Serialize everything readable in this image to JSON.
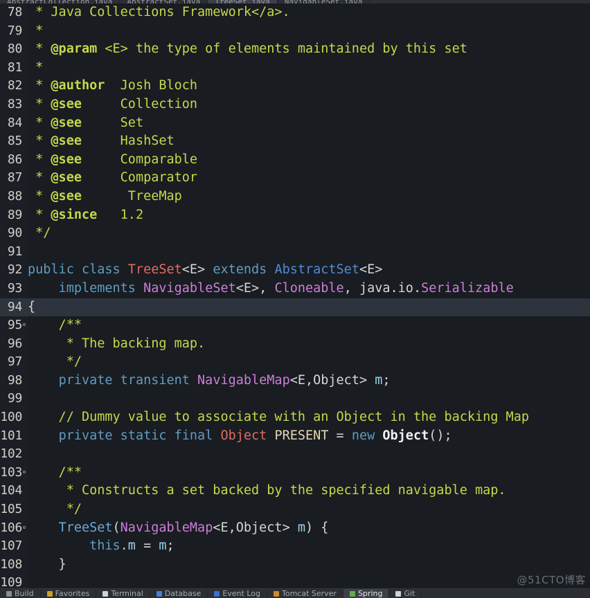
{
  "window": {
    "title": "TreeSet.java",
    "watermark": "@51CTO博客"
  },
  "tabs": [
    {
      "label": "AbstractCollection.java",
      "active": false
    },
    {
      "label": "AbstractSet.java",
      "active": false
    },
    {
      "label": "TreeSet.java",
      "active": true
    },
    {
      "label": "NavigableSet.java",
      "active": false
    }
  ],
  "tool_windows": [
    {
      "label": "Build",
      "icon": "build-icon",
      "color": "#8a8f98",
      "selected": false
    },
    {
      "label": "Favorites",
      "icon": "favorites-icon",
      "color": "#c9a227",
      "selected": false
    },
    {
      "label": "Terminal",
      "icon": "terminal-icon",
      "color": "#cfd2d6",
      "selected": false
    },
    {
      "label": "Database",
      "icon": "database-icon",
      "color": "#4a7fd4",
      "selected": false
    },
    {
      "label": "Event Log",
      "icon": "event-log-icon",
      "color": "#3b6fd0",
      "selected": false
    },
    {
      "label": "Tomcat Server",
      "icon": "tomcat-icon",
      "color": "#d08a2a",
      "selected": false
    },
    {
      "label": "Spring",
      "icon": "spring-icon",
      "color": "#6aa84f",
      "selected": true
    },
    {
      "label": "Git",
      "icon": "git-icon",
      "color": "#cfd2d6",
      "selected": false
    }
  ],
  "editor": {
    "language": "java",
    "first_line": 78,
    "current_line": 94,
    "lines": [
      {
        "n": 78,
        "fold": false,
        "current": false,
        "tokens": [
          {
            "c": "t-cmt",
            "t": " * Java Collections Framework</a>."
          }
        ]
      },
      {
        "n": 79,
        "fold": false,
        "current": false,
        "tokens": [
          {
            "c": "t-cmt",
            "t": " *"
          }
        ]
      },
      {
        "n": 80,
        "fold": false,
        "current": false,
        "tokens": [
          {
            "c": "t-cmt",
            "t": " * "
          },
          {
            "c": "t-cmtb",
            "t": "@param"
          },
          {
            "c": "t-cmt",
            "t": " <E> the type of elements maintained by this set"
          }
        ]
      },
      {
        "n": 81,
        "fold": false,
        "current": false,
        "tokens": [
          {
            "c": "t-cmt",
            "t": " *"
          }
        ]
      },
      {
        "n": 82,
        "fold": false,
        "current": false,
        "tokens": [
          {
            "c": "t-cmt",
            "t": " * "
          },
          {
            "c": "t-cmtb",
            "t": "@author"
          },
          {
            "c": "t-cmt",
            "t": "  Josh Bloch"
          }
        ]
      },
      {
        "n": 83,
        "fold": false,
        "current": false,
        "tokens": [
          {
            "c": "t-cmt",
            "t": " * "
          },
          {
            "c": "t-cmtb",
            "t": "@see"
          },
          {
            "c": "t-cmt",
            "t": "     Collection"
          }
        ]
      },
      {
        "n": 84,
        "fold": false,
        "current": false,
        "tokens": [
          {
            "c": "t-cmt",
            "t": " * "
          },
          {
            "c": "t-cmtb",
            "t": "@see"
          },
          {
            "c": "t-cmt",
            "t": "     Set"
          }
        ]
      },
      {
        "n": 85,
        "fold": false,
        "current": false,
        "tokens": [
          {
            "c": "t-cmt",
            "t": " * "
          },
          {
            "c": "t-cmtb",
            "t": "@see"
          },
          {
            "c": "t-cmt",
            "t": "     HashSet"
          }
        ]
      },
      {
        "n": 86,
        "fold": false,
        "current": false,
        "tokens": [
          {
            "c": "t-cmt",
            "t": " * "
          },
          {
            "c": "t-cmtb",
            "t": "@see"
          },
          {
            "c": "t-cmt",
            "t": "     Comparable"
          }
        ]
      },
      {
        "n": 87,
        "fold": false,
        "current": false,
        "tokens": [
          {
            "c": "t-cmt",
            "t": " * "
          },
          {
            "c": "t-cmtb",
            "t": "@see"
          },
          {
            "c": "t-cmt",
            "t": "     Comparator"
          }
        ]
      },
      {
        "n": 88,
        "fold": false,
        "current": false,
        "tokens": [
          {
            "c": "t-cmt",
            "t": " * "
          },
          {
            "c": "t-cmtb",
            "t": "@see"
          },
          {
            "c": "t-cmt",
            "t": "      TreeMap"
          }
        ]
      },
      {
        "n": 89,
        "fold": false,
        "current": false,
        "tokens": [
          {
            "c": "t-cmt",
            "t": " * "
          },
          {
            "c": "t-cmtb",
            "t": "@since"
          },
          {
            "c": "t-cmt",
            "t": "   1.2"
          }
        ]
      },
      {
        "n": 90,
        "fold": false,
        "current": false,
        "tokens": [
          {
            "c": "t-cmt",
            "t": " */"
          }
        ]
      },
      {
        "n": 91,
        "fold": false,
        "current": false,
        "tokens": []
      },
      {
        "n": 92,
        "fold": false,
        "current": false,
        "tokens": [
          {
            "c": "t-kw",
            "t": "public class "
          },
          {
            "c": "t-cls",
            "t": "TreeSet"
          },
          {
            "c": "t-plain",
            "t": "<E> "
          },
          {
            "c": "t-kw",
            "t": "extends "
          },
          {
            "c": "t-type2",
            "t": "AbstractSet"
          },
          {
            "c": "t-plain",
            "t": "<E>"
          }
        ]
      },
      {
        "n": 93,
        "fold": false,
        "current": false,
        "tokens": [
          {
            "c": "t-plain",
            "t": "    "
          },
          {
            "c": "t-kw",
            "t": "implements "
          },
          {
            "c": "t-iface",
            "t": "NavigableSet"
          },
          {
            "c": "t-plain",
            "t": "<E>, "
          },
          {
            "c": "t-iface",
            "t": "Cloneable"
          },
          {
            "c": "t-plain",
            "t": ", java.io."
          },
          {
            "c": "t-iface",
            "t": "Serializable"
          }
        ]
      },
      {
        "n": 94,
        "fold": false,
        "current": true,
        "tokens": [
          {
            "c": "t-plain",
            "t": "{"
          }
        ]
      },
      {
        "n": 95,
        "fold": true,
        "current": false,
        "tokens": [
          {
            "c": "t-cmt",
            "t": "    /**"
          }
        ]
      },
      {
        "n": 96,
        "fold": false,
        "current": false,
        "tokens": [
          {
            "c": "t-cmt",
            "t": "     * The backing map."
          }
        ]
      },
      {
        "n": 97,
        "fold": false,
        "current": false,
        "tokens": [
          {
            "c": "t-cmt",
            "t": "     */"
          }
        ]
      },
      {
        "n": 98,
        "fold": false,
        "current": false,
        "tokens": [
          {
            "c": "t-plain",
            "t": "    "
          },
          {
            "c": "t-kw",
            "t": "private transient "
          },
          {
            "c": "t-iface",
            "t": "NavigableMap"
          },
          {
            "c": "t-plain",
            "t": "<E,Object> "
          },
          {
            "c": "t-var",
            "t": "m"
          },
          {
            "c": "t-plain",
            "t": ";"
          }
        ]
      },
      {
        "n": 99,
        "fold": false,
        "current": false,
        "tokens": []
      },
      {
        "n": 100,
        "fold": false,
        "current": false,
        "tokens": [
          {
            "c": "t-cmt",
            "t": "    // Dummy value to associate with an Object in the backing Map"
          }
        ]
      },
      {
        "n": 101,
        "fold": false,
        "current": false,
        "tokens": [
          {
            "c": "t-plain",
            "t": "    "
          },
          {
            "c": "t-kw",
            "t": "private static final "
          },
          {
            "c": "t-cls",
            "t": "Object"
          },
          {
            "c": "t-plain",
            "t": " "
          },
          {
            "c": "t-field",
            "t": "PRESENT"
          },
          {
            "c": "t-plain",
            "t": " = "
          },
          {
            "c": "t-kw",
            "t": "new "
          },
          {
            "c": "t-strong",
            "t": "Object"
          },
          {
            "c": "t-plain",
            "t": "();"
          }
        ]
      },
      {
        "n": 102,
        "fold": false,
        "current": false,
        "tokens": []
      },
      {
        "n": 103,
        "fold": true,
        "current": false,
        "tokens": [
          {
            "c": "t-cmt",
            "t": "    /**"
          }
        ]
      },
      {
        "n": 104,
        "fold": false,
        "current": false,
        "tokens": [
          {
            "c": "t-cmt",
            "t": "     * Constructs a set backed by the specified navigable map."
          }
        ]
      },
      {
        "n": 105,
        "fold": false,
        "current": false,
        "tokens": [
          {
            "c": "t-cmt",
            "t": "     */"
          }
        ]
      },
      {
        "n": 106,
        "fold": true,
        "current": false,
        "tokens": [
          {
            "c": "t-plain",
            "t": "    "
          },
          {
            "c": "t-ctor",
            "t": "TreeSet"
          },
          {
            "c": "t-plain",
            "t": "("
          },
          {
            "c": "t-iface",
            "t": "NavigableMap"
          },
          {
            "c": "t-plain",
            "t": "<E,Object> "
          },
          {
            "c": "t-var",
            "t": "m"
          },
          {
            "c": "t-plain",
            "t": ") {"
          }
        ]
      },
      {
        "n": 107,
        "fold": false,
        "current": false,
        "tokens": [
          {
            "c": "t-plain",
            "t": "        "
          },
          {
            "c": "t-kw",
            "t": "this"
          },
          {
            "c": "t-var",
            "t": ".m"
          },
          {
            "c": "t-plain",
            "t": " = "
          },
          {
            "c": "t-var",
            "t": "m"
          },
          {
            "c": "t-plain",
            "t": ";"
          }
        ]
      },
      {
        "n": 108,
        "fold": false,
        "current": false,
        "tokens": [
          {
            "c": "t-plain",
            "t": "    }"
          }
        ]
      },
      {
        "n": 109,
        "fold": false,
        "current": false,
        "tokens": []
      }
    ]
  },
  "colors": {
    "editor_bg": "#191c21",
    "gutter_bg": "#1b1f25",
    "current_line_bg": "#2e343d",
    "comment": "#c5d94a",
    "keyword": "#5f9dc4",
    "class": "#e06c63",
    "interface": "#cb7fd8",
    "type": "#528bd6",
    "field": "#e8d8b0",
    "variable": "#9fd2ef",
    "default_text": "#d6d6d6",
    "line_number": "#d2cfc8"
  }
}
